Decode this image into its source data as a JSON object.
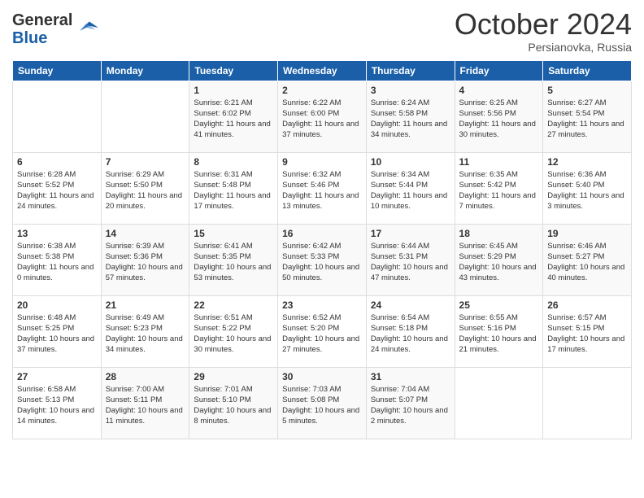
{
  "logo": {
    "line1": "General",
    "line2": "Blue"
  },
  "title": "October 2024",
  "subtitle": "Persianovka, Russia",
  "days_header": [
    "Sunday",
    "Monday",
    "Tuesday",
    "Wednesday",
    "Thursday",
    "Friday",
    "Saturday"
  ],
  "weeks": [
    [
      {
        "day": "",
        "info": ""
      },
      {
        "day": "",
        "info": ""
      },
      {
        "day": "1",
        "info": "Sunrise: 6:21 AM\nSunset: 6:02 PM\nDaylight: 11 hours and 41 minutes."
      },
      {
        "day": "2",
        "info": "Sunrise: 6:22 AM\nSunset: 6:00 PM\nDaylight: 11 hours and 37 minutes."
      },
      {
        "day": "3",
        "info": "Sunrise: 6:24 AM\nSunset: 5:58 PM\nDaylight: 11 hours and 34 minutes."
      },
      {
        "day": "4",
        "info": "Sunrise: 6:25 AM\nSunset: 5:56 PM\nDaylight: 11 hours and 30 minutes."
      },
      {
        "day": "5",
        "info": "Sunrise: 6:27 AM\nSunset: 5:54 PM\nDaylight: 11 hours and 27 minutes."
      }
    ],
    [
      {
        "day": "6",
        "info": "Sunrise: 6:28 AM\nSunset: 5:52 PM\nDaylight: 11 hours and 24 minutes."
      },
      {
        "day": "7",
        "info": "Sunrise: 6:29 AM\nSunset: 5:50 PM\nDaylight: 11 hours and 20 minutes."
      },
      {
        "day": "8",
        "info": "Sunrise: 6:31 AM\nSunset: 5:48 PM\nDaylight: 11 hours and 17 minutes."
      },
      {
        "day": "9",
        "info": "Sunrise: 6:32 AM\nSunset: 5:46 PM\nDaylight: 11 hours and 13 minutes."
      },
      {
        "day": "10",
        "info": "Sunrise: 6:34 AM\nSunset: 5:44 PM\nDaylight: 11 hours and 10 minutes."
      },
      {
        "day": "11",
        "info": "Sunrise: 6:35 AM\nSunset: 5:42 PM\nDaylight: 11 hours and 7 minutes."
      },
      {
        "day": "12",
        "info": "Sunrise: 6:36 AM\nSunset: 5:40 PM\nDaylight: 11 hours and 3 minutes."
      }
    ],
    [
      {
        "day": "13",
        "info": "Sunrise: 6:38 AM\nSunset: 5:38 PM\nDaylight: 11 hours and 0 minutes."
      },
      {
        "day": "14",
        "info": "Sunrise: 6:39 AM\nSunset: 5:36 PM\nDaylight: 10 hours and 57 minutes."
      },
      {
        "day": "15",
        "info": "Sunrise: 6:41 AM\nSunset: 5:35 PM\nDaylight: 10 hours and 53 minutes."
      },
      {
        "day": "16",
        "info": "Sunrise: 6:42 AM\nSunset: 5:33 PM\nDaylight: 10 hours and 50 minutes."
      },
      {
        "day": "17",
        "info": "Sunrise: 6:44 AM\nSunset: 5:31 PM\nDaylight: 10 hours and 47 minutes."
      },
      {
        "day": "18",
        "info": "Sunrise: 6:45 AM\nSunset: 5:29 PM\nDaylight: 10 hours and 43 minutes."
      },
      {
        "day": "19",
        "info": "Sunrise: 6:46 AM\nSunset: 5:27 PM\nDaylight: 10 hours and 40 minutes."
      }
    ],
    [
      {
        "day": "20",
        "info": "Sunrise: 6:48 AM\nSunset: 5:25 PM\nDaylight: 10 hours and 37 minutes."
      },
      {
        "day": "21",
        "info": "Sunrise: 6:49 AM\nSunset: 5:23 PM\nDaylight: 10 hours and 34 minutes."
      },
      {
        "day": "22",
        "info": "Sunrise: 6:51 AM\nSunset: 5:22 PM\nDaylight: 10 hours and 30 minutes."
      },
      {
        "day": "23",
        "info": "Sunrise: 6:52 AM\nSunset: 5:20 PM\nDaylight: 10 hours and 27 minutes."
      },
      {
        "day": "24",
        "info": "Sunrise: 6:54 AM\nSunset: 5:18 PM\nDaylight: 10 hours and 24 minutes."
      },
      {
        "day": "25",
        "info": "Sunrise: 6:55 AM\nSunset: 5:16 PM\nDaylight: 10 hours and 21 minutes."
      },
      {
        "day": "26",
        "info": "Sunrise: 6:57 AM\nSunset: 5:15 PM\nDaylight: 10 hours and 17 minutes."
      }
    ],
    [
      {
        "day": "27",
        "info": "Sunrise: 6:58 AM\nSunset: 5:13 PM\nDaylight: 10 hours and 14 minutes."
      },
      {
        "day": "28",
        "info": "Sunrise: 7:00 AM\nSunset: 5:11 PM\nDaylight: 10 hours and 11 minutes."
      },
      {
        "day": "29",
        "info": "Sunrise: 7:01 AM\nSunset: 5:10 PM\nDaylight: 10 hours and 8 minutes."
      },
      {
        "day": "30",
        "info": "Sunrise: 7:03 AM\nSunset: 5:08 PM\nDaylight: 10 hours and 5 minutes."
      },
      {
        "day": "31",
        "info": "Sunrise: 7:04 AM\nSunset: 5:07 PM\nDaylight: 10 hours and 2 minutes."
      },
      {
        "day": "",
        "info": ""
      },
      {
        "day": "",
        "info": ""
      }
    ]
  ]
}
